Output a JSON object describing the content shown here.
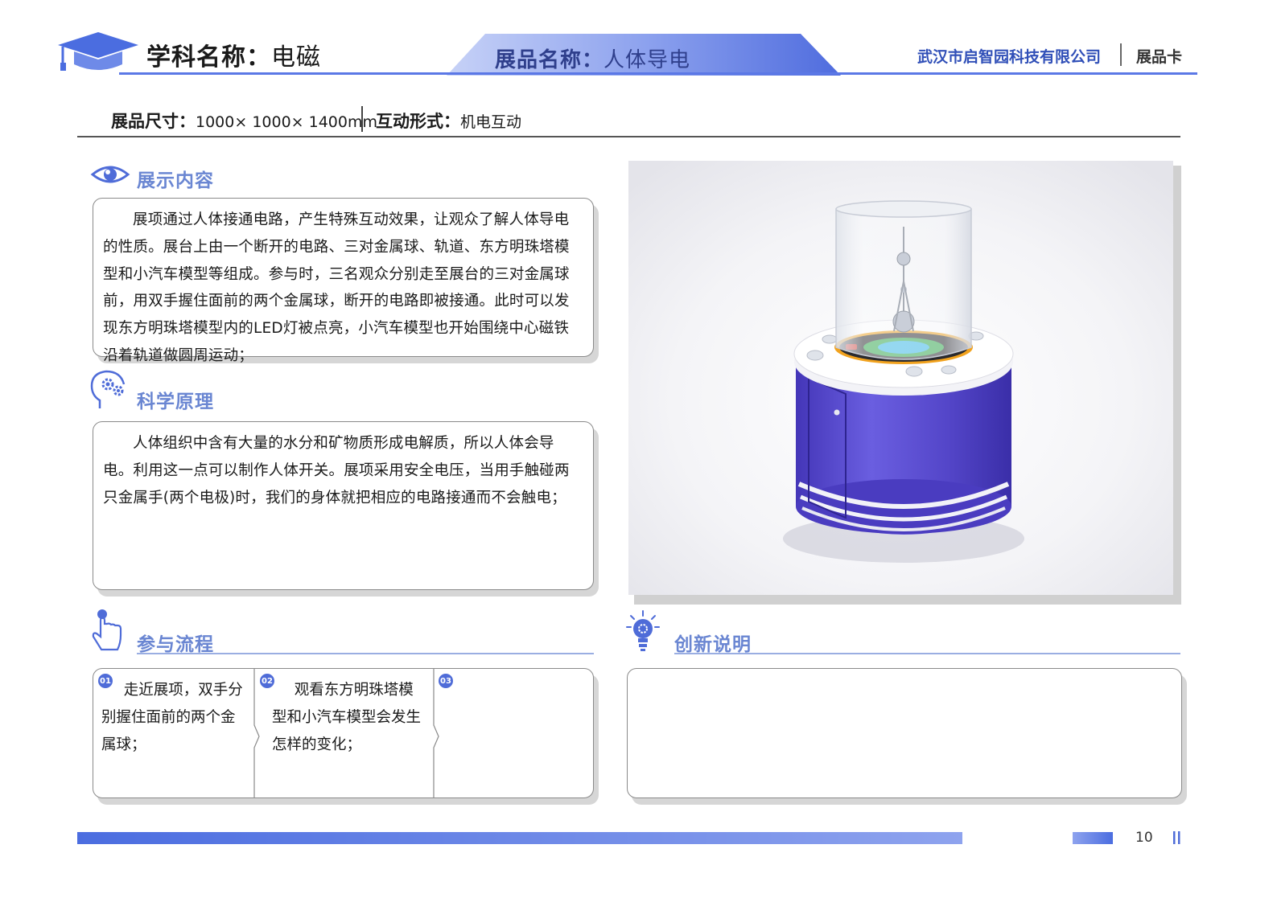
{
  "header": {
    "subject_label": "学科名称：",
    "subject_value": "电磁",
    "exhibit_label": "展品名称：",
    "exhibit_value": "人体导电",
    "company": "武汉市启智园科技有限公司",
    "card_label": "展品卡"
  },
  "specs": {
    "size_label": "展品尺寸：",
    "size_value": "1000× 1000× 1400mm",
    "interaction_label": "互动形式：",
    "interaction_value": "机电互动"
  },
  "sections": {
    "content": {
      "title": "展示内容",
      "text": "展项通过人体接通电路，产生特殊互动效果，让观众了解人体导电的性质。展台上由一个断开的电路、三对金属球、轨道、东方明珠塔模型和小汽车模型等组成。参与时，三名观众分别走至展台的三对金属球前，用双手握住面前的两个金属球，断开的电路即被接通。此时可以发现东方明珠塔模型内的LED灯被点亮，小汽车模型也开始围绕中心磁铁沿着轨道做圆周运动；"
    },
    "principle": {
      "title": "科学原理",
      "text": "人体组织中含有大量的水分和矿物质形成电解质，所以人体会导电。利用这一点可以制作人体开关。展项采用安全电压，当用手触碰两只金属手(两个电极)时，我们的身体就把相应的电路接通而不会触电；"
    },
    "process": {
      "title": "参与流程",
      "steps": [
        {
          "badge": "01",
          "text": "走近展项，双手分别握住面前的两个金属球；"
        },
        {
          "badge": "02",
          "text": "观看东方明珠塔模型和小汽车模型会发生怎样的变化；"
        },
        {
          "badge": "03",
          "text": ""
        }
      ]
    },
    "innovation": {
      "title": "创新说明",
      "text": ""
    }
  },
  "footer": {
    "page_number": "10"
  },
  "colors": {
    "accent": "#4f6cd8",
    "accent_light": "#9aaee2",
    "section_title": "#6a86d2",
    "cabinet": "#5446c9"
  }
}
